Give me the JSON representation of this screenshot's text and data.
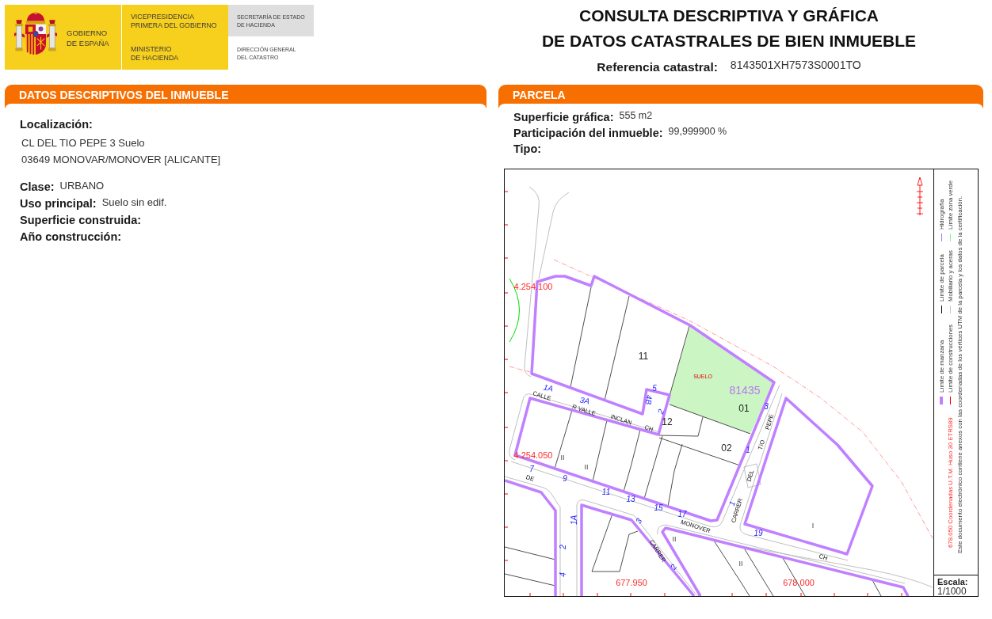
{
  "header": {
    "logo": {
      "government": [
        "GOBIERNO",
        "DE ESPAÑA"
      ],
      "vice_presidency": [
        "VICEPRESIDENCIA",
        "PRIMERA DEL GOBIERNO"
      ],
      "ministry": [
        "MINISTERIO",
        "DE HACIENDA"
      ],
      "secretariat": [
        "SECRETARÍA DE ESTADO",
        "DE HACIENDA"
      ],
      "directorate": [
        "DIRECCIÓN GENERAL",
        "DEL CATASTRO"
      ]
    },
    "title": [
      "CONSULTA DESCRIPTIVA Y GRÁFICA",
      "DE DATOS CATASTRALES DE BIEN INMUEBLE"
    ],
    "reference": {
      "label": "Referencia catastral:",
      "value": "8143501XH7573S0001TO"
    }
  },
  "descriptive_data": {
    "title": "DATOS DESCRIPTIVOS DEL INMUEBLE",
    "location": {
      "label": "Localización:",
      "lines": [
        "CL DEL TIO PEPE 3 Suelo",
        "03649 MONOVAR/MONOVER [ALICANTE]"
      ]
    },
    "fields": [
      {
        "label": "Clase:",
        "value": "URBANO"
      },
      {
        "label": "Uso principal:",
        "value": "Suelo sin edif."
      },
      {
        "label": "Superficie construida:"
      },
      {
        "label": "Año construcción:"
      }
    ]
  },
  "parcel": {
    "title": "PARCELA",
    "fields": [
      {
        "label": "Superficie gráfica:",
        "value": "555 m2"
      },
      {
        "label": "Participación del inmueble:",
        "value": "99,999900 %"
      },
      {
        "label": "Tipo:"
      }
    ],
    "map": {
      "labels": [
        {
          "text": "4.254.100",
          "kind": "coordinate"
        },
        {
          "text": "11",
          "kind": "parcel"
        },
        {
          "text": "SUELO",
          "kind": "use"
        },
        {
          "text": "1A",
          "kind": "house_number"
        },
        {
          "text": "5",
          "kind": "house_number"
        },
        {
          "text": "81435",
          "kind": "block"
        },
        {
          "text": "CALLE",
          "kind": "street"
        },
        {
          "text": "4B",
          "kind": "house_number"
        },
        {
          "text": "3A",
          "kind": "house_number"
        },
        {
          "text": "R VALLE",
          "kind": "street"
        },
        {
          "text": "01",
          "kind": "parcel"
        },
        {
          "text": "PEPE",
          "kind": "street"
        },
        {
          "text": "3",
          "kind": "house_number"
        },
        {
          "text": "2",
          "kind": "house_number"
        },
        {
          "text": "INCLAN",
          "kind": "street"
        },
        {
          "text": "12",
          "kind": "parcel"
        },
        {
          "text": "CH",
          "kind": "street"
        },
        {
          "text": "TIO",
          "kind": "street"
        },
        {
          "text": "02",
          "kind": "parcel"
        },
        {
          "text": "1",
          "kind": "house_number"
        },
        {
          "text": "4.254.050",
          "kind": "coordinate"
        },
        {
          "text": "II",
          "kind": "floors"
        },
        {
          "text": "II",
          "kind": "floors"
        },
        {
          "text": "7",
          "kind": "house_number"
        },
        {
          "text": "DEL",
          "kind": "street"
        },
        {
          "text": "DE",
          "kind": "street"
        },
        {
          "text": "9",
          "kind": "house_number"
        },
        {
          "text": "11",
          "kind": "house_number"
        },
        {
          "text": "13",
          "kind": "house_number"
        },
        {
          "text": "1",
          "kind": "house_number"
        },
        {
          "text": "15",
          "kind": "house_number"
        },
        {
          "text": "CARRER",
          "kind": "street"
        },
        {
          "text": "17",
          "kind": "house_number"
        },
        {
          "text": "1A",
          "kind": "house_number"
        },
        {
          "text": "3",
          "kind": "house_number"
        },
        {
          "text": "I",
          "kind": "floors"
        },
        {
          "text": "MONOVER",
          "kind": "street"
        },
        {
          "text": "19",
          "kind": "house_number"
        },
        {
          "text": "II",
          "kind": "floors"
        },
        {
          "text": "2",
          "kind": "house_number"
        },
        {
          "text": "CARRER",
          "kind": "street"
        },
        {
          "text": "CH",
          "kind": "street"
        },
        {
          "text": "II",
          "kind": "floors"
        },
        {
          "text": "2",
          "kind": "house_number"
        },
        {
          "text": "4",
          "kind": "house_number"
        },
        {
          "text": "677.950",
          "kind": "coordinate"
        },
        {
          "text": "678.000",
          "kind": "coordinate"
        }
      ],
      "legend": [
        {
          "label": "Límite de manzana",
          "kind": "band",
          "color": "#c080ff"
        },
        {
          "label": "Límite de parcela",
          "kind": "line",
          "color": "#000000"
        },
        {
          "label": "Hidrografía",
          "kind": "line",
          "color": "#8080ff"
        },
        {
          "label": "Límite de construcciones",
          "kind": "line",
          "color": "#ff0000"
        },
        {
          "label": "Mobiliario y aceras",
          "kind": "line",
          "color": "#c8c8c8"
        },
        {
          "label": "Límite zona verde",
          "kind": "line",
          "color": "#80ff80"
        }
      ],
      "coordinate_note": "678.050 Coordenadas U.T.M. Huso 30 ETRS89",
      "certification_note": "Este documento electrónico contiene anexos con las coordenadas de los vértices UTM de la parcela y los datos de la certificación.",
      "scale": {
        "label": "Escala:",
        "value": "1/1000"
      }
    }
  }
}
